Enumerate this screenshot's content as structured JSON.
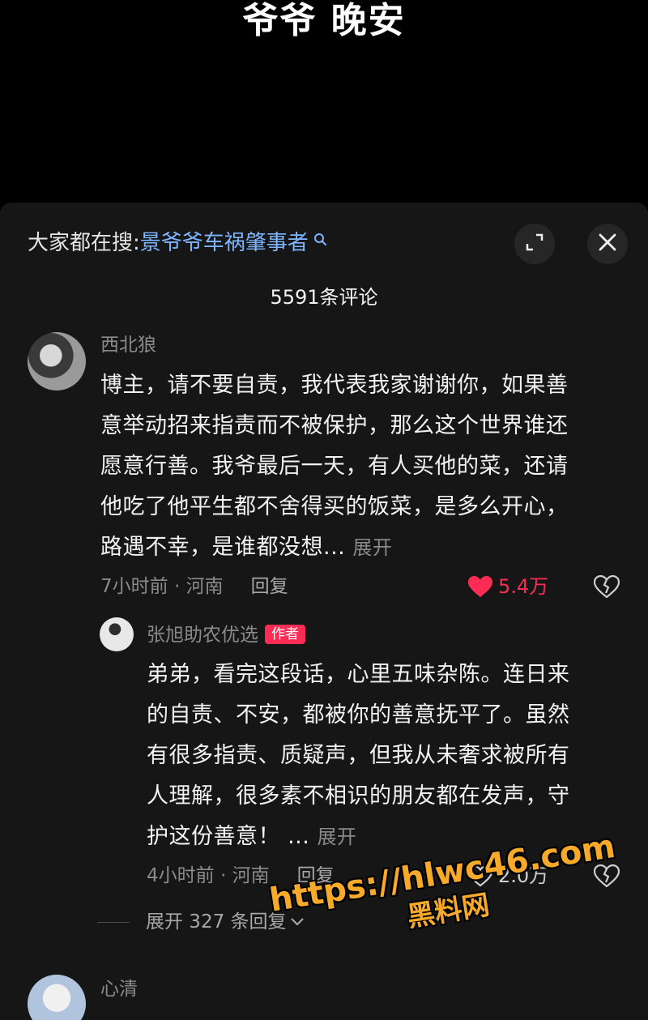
{
  "video": {
    "caption": "爷爷 晚安"
  },
  "search": {
    "prefix": "大家都在搜:",
    "term": "景爷爷车祸肇事者"
  },
  "comments_header": {
    "count_label": "5591条评论"
  },
  "comments": [
    {
      "user": "西北狼",
      "lines": [
        "博主，请不要自责，我代表我家谢谢你，如果善",
        "意举动招来指责而不被保护，那么这个世界谁还",
        "愿意行善。我爷最后一天，有人买他的菜，还请",
        "他吃了他平生都不舍得买的饭菜，是多么开心，",
        "路遇不幸，是谁都没想..."
      ],
      "expand": "展开",
      "meta": "7小时前 · 河南",
      "reply": "回复",
      "likes": "5.4万",
      "liked": true,
      "like_color": "#fe2c55"
    }
  ],
  "reply": {
    "user": "张旭助农优选",
    "badge": "作者",
    "badge_color": "#fe2c55",
    "lines": [
      "弟弟，看完这段话，心里五味杂陈。连日来",
      "的自责、不安，都被你的善意抚平了。虽然",
      "有很多指责、质疑声，但我从未奢求被所有",
      "人理解，很多素不相识的朋友都在发声，守",
      "护这份善意！ ..."
    ],
    "expand": "展开",
    "meta": "4小时前 · 河南",
    "reply_label": "回复",
    "likes": "2.0万",
    "liked": false
  },
  "expand_replies": {
    "label": "展开 327 条回复"
  },
  "next_comment": {
    "user": "心清"
  },
  "watermark": {
    "url": "https://hlwc46.com",
    "name": "黑料网",
    "color": "#f7a92a"
  },
  "icons": {
    "search_term": "search-icon",
    "expand": "expand-icon",
    "close": "close-icon",
    "like_filled": "heart-filled-icon",
    "like_outline": "heart-outline-icon",
    "dislike": "broken-heart-icon",
    "chevron": "chevron-down-icon"
  }
}
